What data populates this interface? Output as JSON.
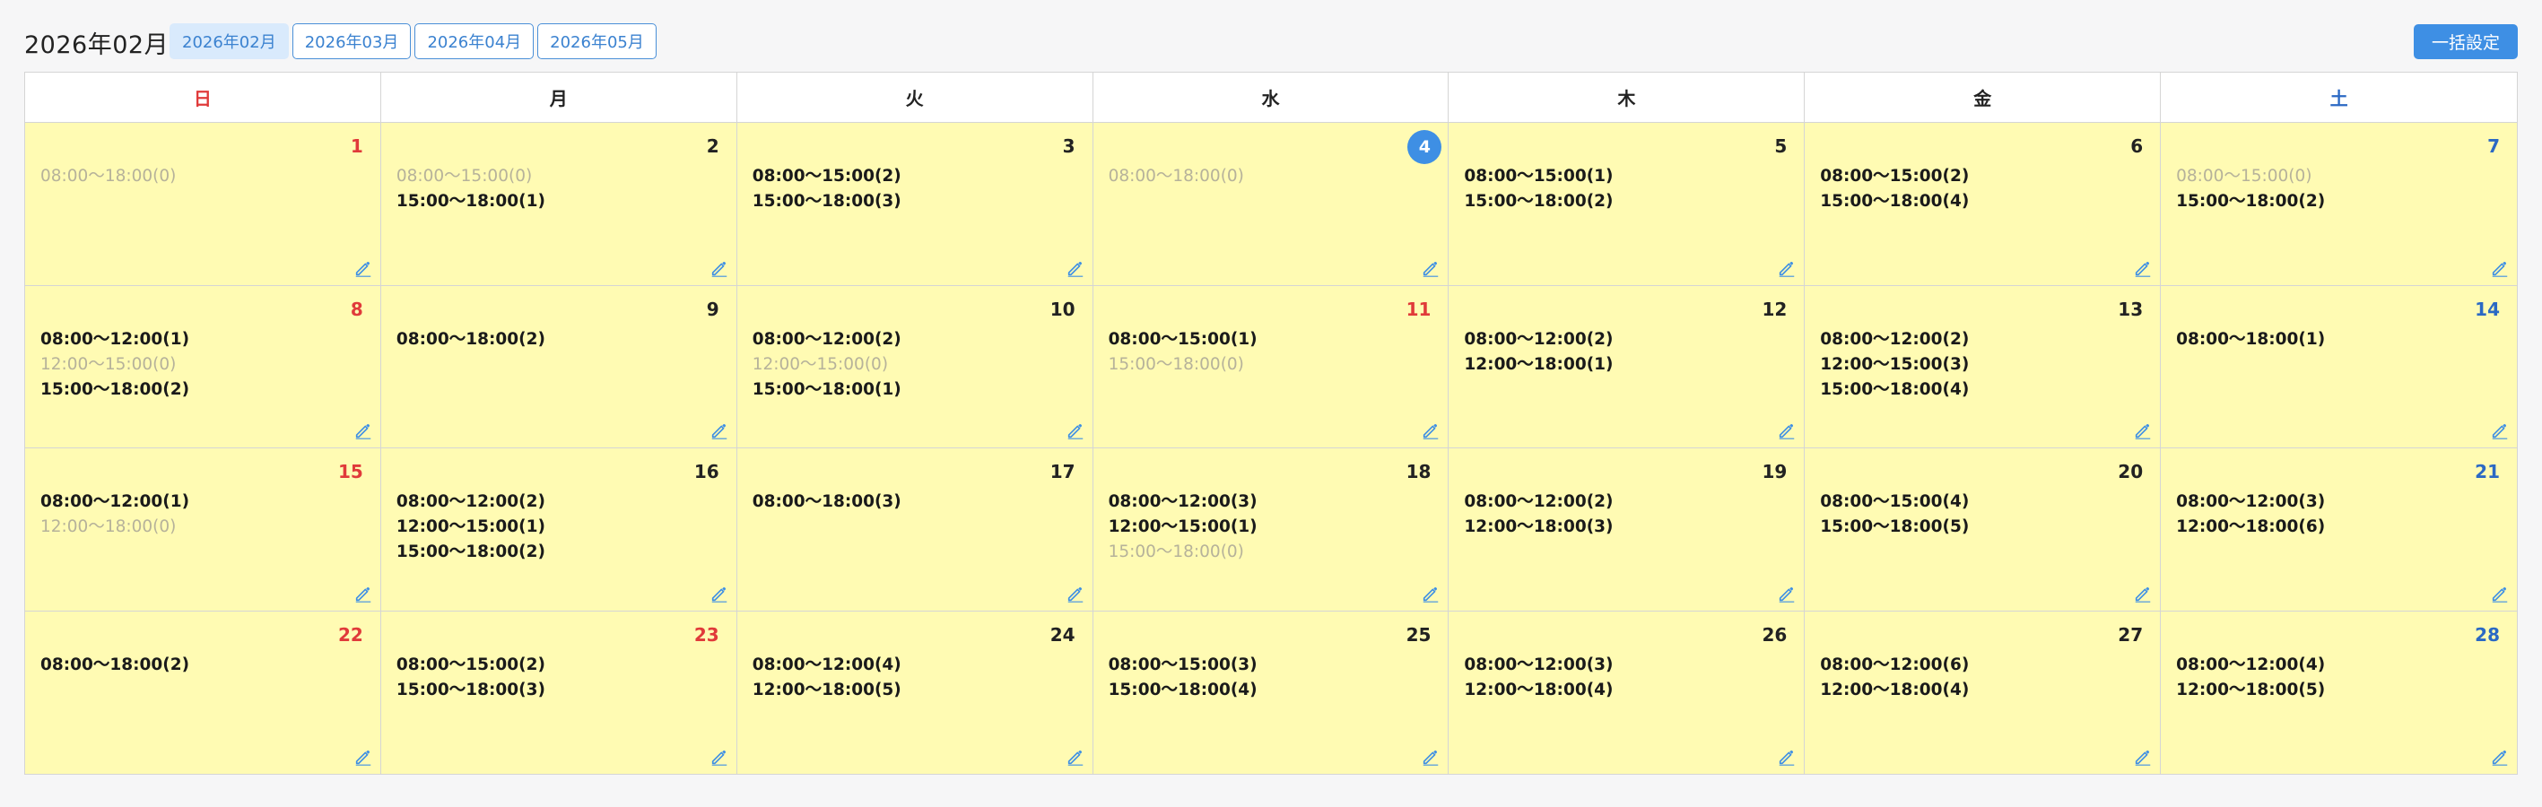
{
  "header": {
    "title": "2026年02月",
    "tabs": [
      {
        "label": "2026年02月",
        "active": true
      },
      {
        "label": "2026年03月",
        "active": false
      },
      {
        "label": "2026年04月",
        "active": false
      },
      {
        "label": "2026年05月",
        "active": false
      }
    ],
    "bulk_button": "一括設定"
  },
  "colors": {
    "accent": "#3e8fe4",
    "cell_background": "#fffbb3",
    "sunday_holiday": "#e03a3a",
    "saturday": "#2b69c4",
    "empty_slot": "#b6b29a"
  },
  "calendar": {
    "weekdays": [
      {
        "label": "日",
        "type": "sun"
      },
      {
        "label": "月",
        "type": ""
      },
      {
        "label": "火",
        "type": ""
      },
      {
        "label": "水",
        "type": ""
      },
      {
        "label": "木",
        "type": ""
      },
      {
        "label": "金",
        "type": ""
      },
      {
        "label": "土",
        "type": "sat"
      }
    ],
    "days": [
      {
        "day": "1",
        "color": "red",
        "slots": [
          {
            "text": "08:00〜18:00(0)",
            "empty": true
          }
        ]
      },
      {
        "day": "2",
        "color": "",
        "slots": [
          {
            "text": "08:00〜15:00(0)",
            "empty": true
          },
          {
            "text": "15:00〜18:00(1)",
            "empty": false
          }
        ]
      },
      {
        "day": "3",
        "color": "",
        "slots": [
          {
            "text": "08:00〜15:00(2)",
            "empty": false
          },
          {
            "text": "15:00〜18:00(3)",
            "empty": false
          }
        ]
      },
      {
        "day": "4",
        "color": "today",
        "slots": [
          {
            "text": "08:00〜18:00(0)",
            "empty": true
          }
        ]
      },
      {
        "day": "5",
        "color": "",
        "slots": [
          {
            "text": "08:00〜15:00(1)",
            "empty": false
          },
          {
            "text": "15:00〜18:00(2)",
            "empty": false
          }
        ]
      },
      {
        "day": "6",
        "color": "",
        "slots": [
          {
            "text": "08:00〜15:00(2)",
            "empty": false
          },
          {
            "text": "15:00〜18:00(4)",
            "empty": false
          }
        ]
      },
      {
        "day": "7",
        "color": "blue",
        "slots": [
          {
            "text": "08:00〜15:00(0)",
            "empty": true
          },
          {
            "text": "15:00〜18:00(2)",
            "empty": false
          }
        ]
      },
      {
        "day": "8",
        "color": "red",
        "slots": [
          {
            "text": "08:00〜12:00(1)",
            "empty": false
          },
          {
            "text": "12:00〜15:00(0)",
            "empty": true
          },
          {
            "text": "15:00〜18:00(2)",
            "empty": false
          }
        ]
      },
      {
        "day": "9",
        "color": "",
        "slots": [
          {
            "text": "08:00〜18:00(2)",
            "empty": false
          }
        ]
      },
      {
        "day": "10",
        "color": "",
        "slots": [
          {
            "text": "08:00〜12:00(2)",
            "empty": false
          },
          {
            "text": "12:00〜15:00(0)",
            "empty": true
          },
          {
            "text": "15:00〜18:00(1)",
            "empty": false
          }
        ]
      },
      {
        "day": "11",
        "color": "red",
        "slots": [
          {
            "text": "08:00〜15:00(1)",
            "empty": false
          },
          {
            "text": "15:00〜18:00(0)",
            "empty": true
          }
        ]
      },
      {
        "day": "12",
        "color": "",
        "slots": [
          {
            "text": "08:00〜12:00(2)",
            "empty": false
          },
          {
            "text": "12:00〜18:00(1)",
            "empty": false
          }
        ]
      },
      {
        "day": "13",
        "color": "",
        "slots": [
          {
            "text": "08:00〜12:00(2)",
            "empty": false
          },
          {
            "text": "12:00〜15:00(3)",
            "empty": false
          },
          {
            "text": "15:00〜18:00(4)",
            "empty": false
          }
        ]
      },
      {
        "day": "14",
        "color": "blue",
        "slots": [
          {
            "text": "08:00〜18:00(1)",
            "empty": false
          }
        ]
      },
      {
        "day": "15",
        "color": "red",
        "slots": [
          {
            "text": "08:00〜12:00(1)",
            "empty": false
          },
          {
            "text": "12:00〜18:00(0)",
            "empty": true
          }
        ]
      },
      {
        "day": "16",
        "color": "",
        "slots": [
          {
            "text": "08:00〜12:00(2)",
            "empty": false
          },
          {
            "text": "12:00〜15:00(1)",
            "empty": false
          },
          {
            "text": "15:00〜18:00(2)",
            "empty": false
          }
        ]
      },
      {
        "day": "17",
        "color": "",
        "slots": [
          {
            "text": "08:00〜18:00(3)",
            "empty": false
          }
        ]
      },
      {
        "day": "18",
        "color": "",
        "slots": [
          {
            "text": "08:00〜12:00(3)",
            "empty": false
          },
          {
            "text": "12:00〜15:00(1)",
            "empty": false
          },
          {
            "text": "15:00〜18:00(0)",
            "empty": true
          }
        ]
      },
      {
        "day": "19",
        "color": "",
        "slots": [
          {
            "text": "08:00〜12:00(2)",
            "empty": false
          },
          {
            "text": "12:00〜18:00(3)",
            "empty": false
          }
        ]
      },
      {
        "day": "20",
        "color": "",
        "slots": [
          {
            "text": "08:00〜15:00(4)",
            "empty": false
          },
          {
            "text": "15:00〜18:00(5)",
            "empty": false
          }
        ]
      },
      {
        "day": "21",
        "color": "blue",
        "slots": [
          {
            "text": "08:00〜12:00(3)",
            "empty": false
          },
          {
            "text": "12:00〜18:00(6)",
            "empty": false
          }
        ]
      },
      {
        "day": "22",
        "color": "red",
        "slots": [
          {
            "text": "08:00〜18:00(2)",
            "empty": false
          }
        ]
      },
      {
        "day": "23",
        "color": "red",
        "slots": [
          {
            "text": "08:00〜15:00(2)",
            "empty": false
          },
          {
            "text": "15:00〜18:00(3)",
            "empty": false
          }
        ]
      },
      {
        "day": "24",
        "color": "",
        "slots": [
          {
            "text": "08:00〜12:00(4)",
            "empty": false
          },
          {
            "text": "12:00〜18:00(5)",
            "empty": false
          }
        ]
      },
      {
        "day": "25",
        "color": "",
        "slots": [
          {
            "text": "08:00〜15:00(3)",
            "empty": false
          },
          {
            "text": "15:00〜18:00(4)",
            "empty": false
          }
        ]
      },
      {
        "day": "26",
        "color": "",
        "slots": [
          {
            "text": "08:00〜12:00(3)",
            "empty": false
          },
          {
            "text": "12:00〜18:00(4)",
            "empty": false
          }
        ]
      },
      {
        "day": "27",
        "color": "",
        "slots": [
          {
            "text": "08:00〜12:00(6)",
            "empty": false
          },
          {
            "text": "12:00〜18:00(4)",
            "empty": false
          }
        ]
      },
      {
        "day": "28",
        "color": "blue",
        "slots": [
          {
            "text": "08:00〜12:00(4)",
            "empty": false
          },
          {
            "text": "12:00〜18:00(5)",
            "empty": false
          }
        ]
      }
    ],
    "edit_icon": "pencil-icon"
  }
}
